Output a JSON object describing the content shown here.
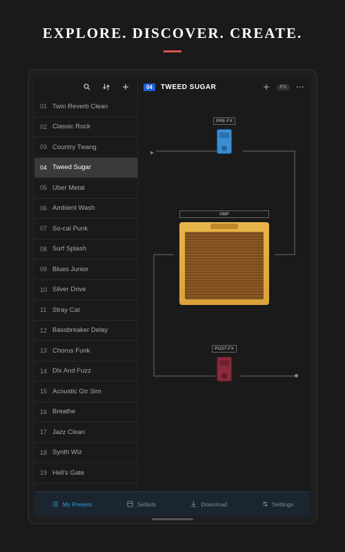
{
  "page": {
    "title": "EXPLORE. DISCOVER. CREATE."
  },
  "sidebar": {
    "toolbar": {
      "search": "search",
      "sort": "sort",
      "add": "add"
    }
  },
  "presets": [
    {
      "num": "01",
      "name": "Twin Reverb Clean"
    },
    {
      "num": "02",
      "name": "Classic Rock"
    },
    {
      "num": "03",
      "name": "Country Twang"
    },
    {
      "num": "04",
      "name": "Tweed Sugar"
    },
    {
      "num": "05",
      "name": "Uber Metal"
    },
    {
      "num": "06",
      "name": "Ambient Wash"
    },
    {
      "num": "07",
      "name": "So-cal Punk"
    },
    {
      "num": "08",
      "name": "Surf Splash"
    },
    {
      "num": "09",
      "name": "Blues Junior"
    },
    {
      "num": "10",
      "name": "Silver Drive"
    },
    {
      "num": "11",
      "name": "Stray Cat"
    },
    {
      "num": "12",
      "name": "Bassbreaker Delay"
    },
    {
      "num": "13",
      "name": "Chorus Funk"
    },
    {
      "num": "14",
      "name": "Dlx And Fuzz"
    },
    {
      "num": "15",
      "name": "Acoustic Gtr Sim"
    },
    {
      "num": "16",
      "name": "Breathe"
    },
    {
      "num": "17",
      "name": "Jazz Clean"
    },
    {
      "num": "18",
      "name": "Synth Wiz"
    },
    {
      "num": "19",
      "name": "Hell's Gate"
    }
  ],
  "selected_index": 3,
  "main": {
    "header": {
      "badge": "04",
      "title": "TWEED SUGAR",
      "fx_pill": "FX"
    },
    "chain": {
      "prefx_label": "PRE-FX",
      "amp_label": "AMP",
      "postfx_label": "POST-FX"
    }
  },
  "bottom_nav": {
    "items": [
      {
        "label": "My Presets",
        "icon": "list",
        "active": true
      },
      {
        "label": "Setlists",
        "icon": "setlist",
        "active": false
      },
      {
        "label": "Download",
        "icon": "download",
        "active": false
      },
      {
        "label": "Settings",
        "icon": "sliders",
        "active": false
      }
    ]
  },
  "colors": {
    "accent_red": "#d9534f",
    "accent_blue": "#3a9dd6",
    "amp_yellow": "#e8b648"
  }
}
